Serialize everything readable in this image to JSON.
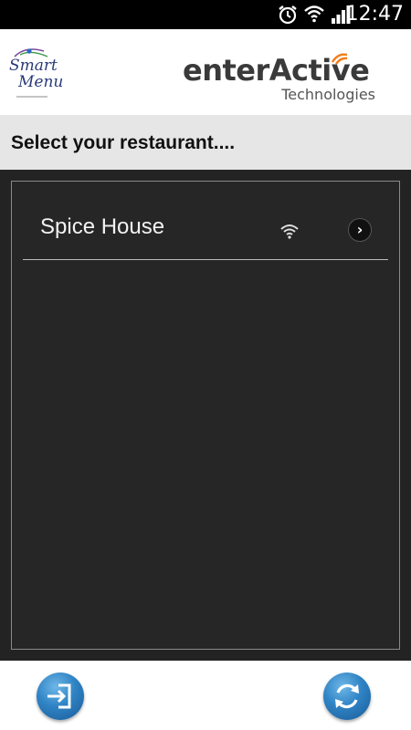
{
  "status_bar": {
    "time": "12:47",
    "icons": [
      "alarm-icon",
      "wifi-icon",
      "signal-icon"
    ]
  },
  "header": {
    "app_logo": {
      "line1": "Smart",
      "line2": "Menu"
    },
    "brand": {
      "name_part1": "enterA",
      "name_part2": "ctive",
      "tagline": "Technologies"
    }
  },
  "title": "Select your restaurant....",
  "restaurants": [
    {
      "name": "Spice House",
      "icons": [
        "wifi-icon",
        "chevron-right-icon"
      ]
    }
  ],
  "bottom_bar": {
    "buttons": [
      "login-icon",
      "refresh-icon"
    ]
  },
  "colors": {
    "brand_orange": "#f07d1a",
    "button_blue": "#2f83c4",
    "list_background": "#262626",
    "title_bar": "#e6e6e6"
  }
}
